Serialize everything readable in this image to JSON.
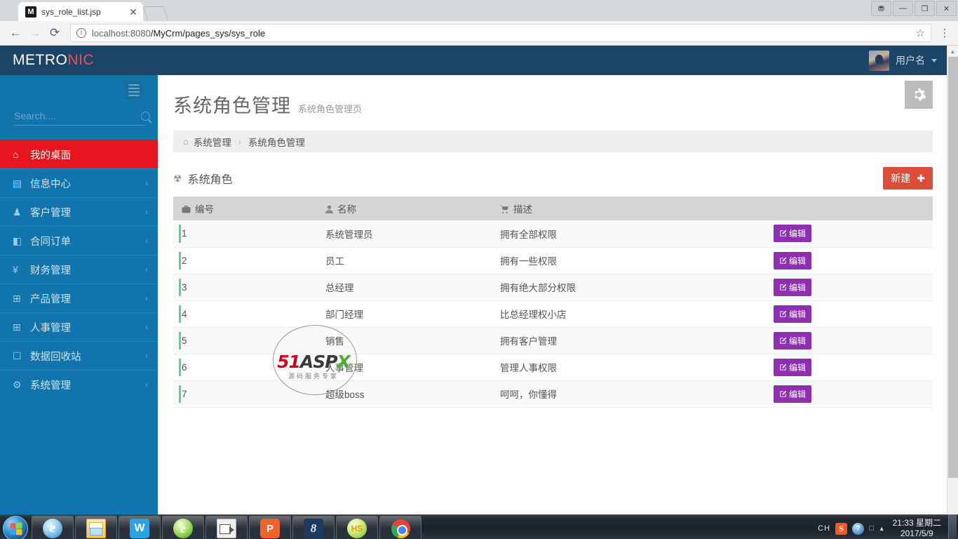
{
  "browser": {
    "tab": {
      "favicon_letter": "M",
      "title": "sys_role_list.jsp",
      "close_icon": "✕"
    },
    "back_icon": "←",
    "forward_icon": "→",
    "reload_icon": "⟳",
    "info_icon": "i",
    "url_host": "localhost:8080",
    "url_path": "/MyCrm/pages_sys/sys_role",
    "star_icon": "☆",
    "menu_icon": "⋮",
    "window_controls": {
      "profile": "⛃",
      "minimize": "—",
      "maximize": "❐",
      "close": "✕"
    }
  },
  "navbar": {
    "brand_main": "METRO",
    "brand_accent": "NIC",
    "brand_accent_color": "#e7505a",
    "user_name": "用户名"
  },
  "sidebar": {
    "bg_color": "#1274ad",
    "active_color": "#e7151f",
    "search_placeholder": "Search....",
    "search_value": "",
    "items": [
      {
        "label": "我的桌面",
        "icon": "home-icon",
        "glyph": "⌂",
        "active": true,
        "arrow": ""
      },
      {
        "label": "信息中心",
        "icon": "news-icon",
        "glyph": "▤",
        "active": false,
        "arrow": "‹"
      },
      {
        "label": "客户管理",
        "icon": "person-icon",
        "glyph": "♟",
        "active": false,
        "arrow": "‹"
      },
      {
        "label": "合同订单",
        "icon": "book-icon",
        "glyph": "◧",
        "active": false,
        "arrow": "‹"
      },
      {
        "label": "财务管理",
        "icon": "yen-icon",
        "glyph": "¥",
        "active": false,
        "arrow": "‹"
      },
      {
        "label": "产品管理",
        "icon": "grid-icon",
        "glyph": "⊞",
        "active": false,
        "arrow": "‹"
      },
      {
        "label": "人事管理",
        "icon": "grid-icon",
        "glyph": "⊞",
        "active": false,
        "arrow": "‹"
      },
      {
        "label": "数据回收站",
        "icon": "trash-icon",
        "glyph": "☐",
        "active": false,
        "arrow": "‹"
      },
      {
        "label": "系统管理",
        "icon": "gear-icon",
        "glyph": "⚙",
        "active": false,
        "arrow": "‹"
      }
    ]
  },
  "page": {
    "title": "系统角色管理",
    "subtitle": "系统角色管理页",
    "gear_icon": "⚙",
    "breadcrumb": {
      "home_icon": "⌂",
      "items": [
        "系统管理",
        "系统角色管理"
      ],
      "separator": "›"
    }
  },
  "portlet": {
    "title": "系统角色",
    "bell_icon": "☢",
    "new_button": {
      "label": "新建",
      "plus": "✚",
      "color": "#dd4b39"
    }
  },
  "table": {
    "columns": [
      {
        "key": "id",
        "label": "编号",
        "icon": "briefcase-icon",
        "glyph": "Ὃc"
      },
      {
        "key": "name",
        "label": "名称",
        "icon": "user-icon",
        "glyph": "♟"
      },
      {
        "key": "desc",
        "label": "描述",
        "icon": "cart-icon",
        "glyph": "☒"
      }
    ],
    "edit_button": {
      "label": "编辑",
      "icon": "edit-pencil-icon",
      "glyph": "✎",
      "color": "#8e2eb0"
    },
    "rows": [
      {
        "id": "1",
        "name": "系统管理员",
        "desc": "拥有全部权限"
      },
      {
        "id": "2",
        "name": "员工",
        "desc": "拥有一些权限"
      },
      {
        "id": "3",
        "name": "总经理",
        "desc": "拥有绝大部分权限"
      },
      {
        "id": "4",
        "name": "部门经理",
        "desc": "比总经理权小店"
      },
      {
        "id": "5",
        "name": "销售",
        "desc": "拥有客户管理"
      },
      {
        "id": "6",
        "name": "人事管理",
        "desc": "管理人事权限"
      },
      {
        "id": "7",
        "name": "超级boss",
        "desc": "呵呵，你懂得"
      }
    ]
  },
  "watermark": {
    "part1": "51",
    "part2": "ASP",
    "part3": "X",
    "subtitle": "源码服务专家"
  },
  "taskbar": {
    "start_label": "Start",
    "items": [
      {
        "name": "internet-explorer",
        "class": "ic-ie",
        "glyph": "e"
      },
      {
        "name": "file-explorer",
        "class": "ic-folder",
        "glyph": ""
      },
      {
        "name": "wps-writer",
        "class": "ic-wps",
        "glyph": "W"
      },
      {
        "name": "green-browser",
        "class": "ic-ie2",
        "glyph": "e"
      },
      {
        "name": "screen-recorder",
        "class": "ic-cam",
        "glyph": ""
      },
      {
        "name": "wps-presentation",
        "class": "ic-wpp",
        "glyph": "P"
      },
      {
        "name": "editplus",
        "class": "ic-num8",
        "glyph": "8"
      },
      {
        "name": "hs-app",
        "class": "ic-hs",
        "glyph": "HS"
      },
      {
        "name": "google-chrome",
        "class": "ic-chrome",
        "glyph": ""
      }
    ],
    "tray": {
      "language": "CH",
      "sogou_icon": "S",
      "help_icon": "?",
      "network_icon": "□",
      "expand_icon": "▲",
      "time": "21:33 星期二",
      "date": "2017/5/9"
    }
  }
}
